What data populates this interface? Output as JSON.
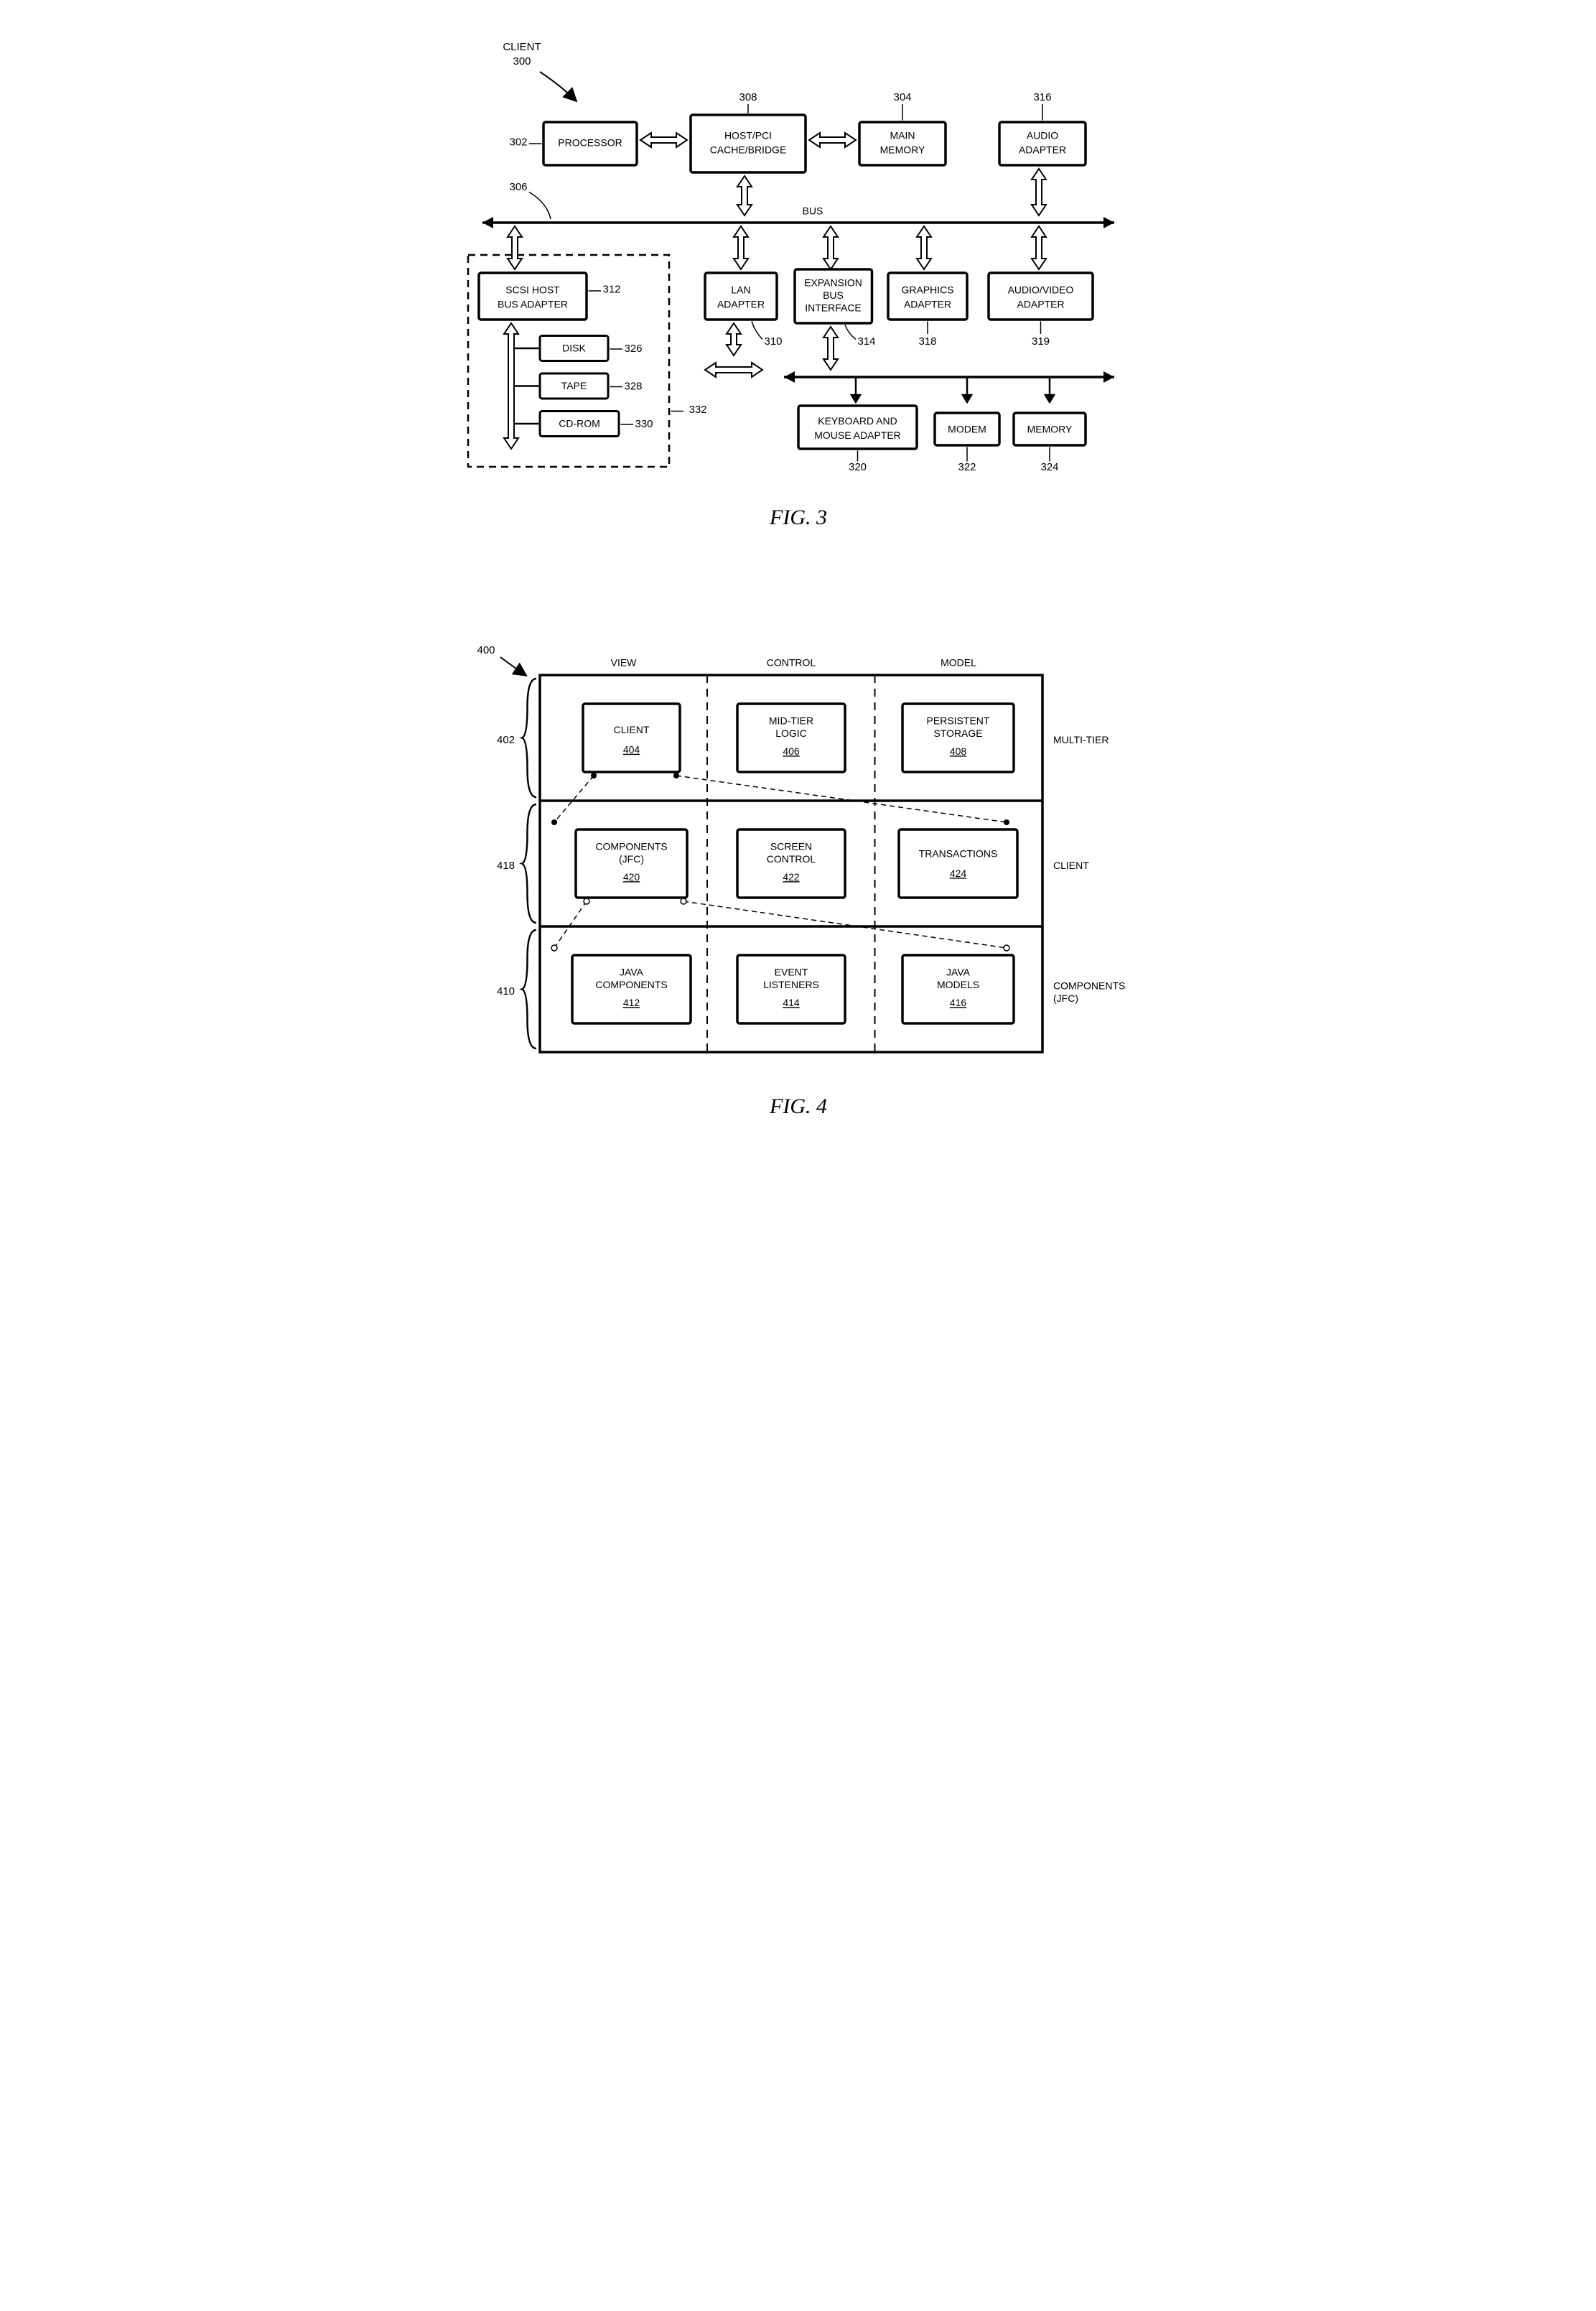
{
  "fig3": {
    "title_label": "CLIENT",
    "title_ref": "300",
    "boxes": {
      "processor": {
        "text": "PROCESSOR",
        "ref": "302"
      },
      "hostpci": {
        "l1": "HOST/PCI",
        "l2": "CACHE/BRIDGE",
        "ref": "308"
      },
      "mainmem": {
        "l1": "MAIN",
        "l2": "MEMORY",
        "ref": "304"
      },
      "audioadp": {
        "l1": "AUDIO",
        "l2": "ADAPTER",
        "ref": "316"
      },
      "bus": {
        "text": "BUS",
        "ref": "306"
      },
      "scsi": {
        "l1": "SCSI HOST",
        "l2": "BUS ADAPTER",
        "ref": "312"
      },
      "lan": {
        "l1": "LAN",
        "l2": "ADAPTER",
        "ref": "310"
      },
      "expbus": {
        "l1": "EXPANSION",
        "l2": "BUS",
        "l3": "INTERFACE",
        "ref": "314"
      },
      "graphics": {
        "l1": "GRAPHICS",
        "l2": "ADAPTER",
        "ref": "318"
      },
      "av": {
        "l1": "AUDIO/VIDEO",
        "l2": "ADAPTER",
        "ref": "319"
      },
      "disk": {
        "text": "DISK",
        "ref": "326"
      },
      "tape": {
        "text": "TAPE",
        "ref": "328"
      },
      "cdrom": {
        "text": "CD-ROM",
        "ref": "330"
      },
      "dashedgrp": {
        "ref": "332"
      },
      "kbmouse": {
        "l1": "KEYBOARD AND",
        "l2": "MOUSE ADAPTER",
        "ref": "320"
      },
      "modem": {
        "text": "MODEM",
        "ref": "322"
      },
      "memory": {
        "text": "MEMORY",
        "ref": "324"
      }
    },
    "figcaption": "FIG.  3"
  },
  "fig4": {
    "ref": "400",
    "columns": {
      "view": "VIEW",
      "control": "CONTROL",
      "model": "MODEL"
    },
    "rows": {
      "r1": {
        "label": "MULTI-TIER",
        "ref": "402",
        "view": {
          "text": "CLIENT",
          "ref": "404"
        },
        "control": {
          "l1": "MID-TIER",
          "l2": "LOGIC",
          "ref": "406"
        },
        "model": {
          "l1": "PERSISTENT",
          "l2": "STORAGE",
          "ref": "408"
        }
      },
      "r2": {
        "label": "CLIENT",
        "ref": "418",
        "view": {
          "l1": "COMPONENTS",
          "l2": "(JFC)",
          "ref": "420"
        },
        "control": {
          "l1": "SCREEN",
          "l2": "CONTROL",
          "ref": "422"
        },
        "model": {
          "text": "TRANSACTIONS",
          "ref": "424"
        }
      },
      "r3": {
        "l1": "COMPONENTS",
        "l2": "(JFC)",
        "ref": "410",
        "view": {
          "l1": "JAVA",
          "l2": "COMPONENTS",
          "ref": "412"
        },
        "control": {
          "l1": "EVENT",
          "l2": "LISTENERS",
          "ref": "414"
        },
        "model": {
          "l1": "JAVA",
          "l2": "MODELS",
          "ref": "416"
        }
      }
    },
    "figcaption": "FIG.  4"
  }
}
